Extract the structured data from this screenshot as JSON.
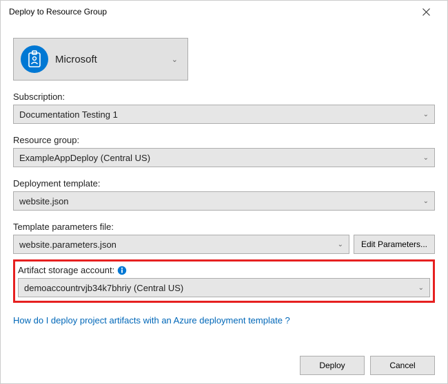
{
  "window": {
    "title": "Deploy to Resource Group"
  },
  "account": {
    "name": "Microsoft"
  },
  "subscription": {
    "label": "Subscription:",
    "value": "Documentation Testing 1"
  },
  "resourceGroup": {
    "label": "Resource group:",
    "value": "ExampleAppDeploy (Central US)"
  },
  "deploymentTemplate": {
    "label": "Deployment template:",
    "value": "website.json"
  },
  "parametersFile": {
    "label": "Template parameters file:",
    "value": "website.parameters.json",
    "editButton": "Edit Parameters..."
  },
  "artifactStorage": {
    "label": "Artifact storage account:",
    "value": "demoaccountrvjb34k7bhriy (Central US)"
  },
  "helpLink": "How do I deploy project artifacts with an Azure deployment template ?",
  "buttons": {
    "deploy": "Deploy",
    "cancel": "Cancel"
  }
}
